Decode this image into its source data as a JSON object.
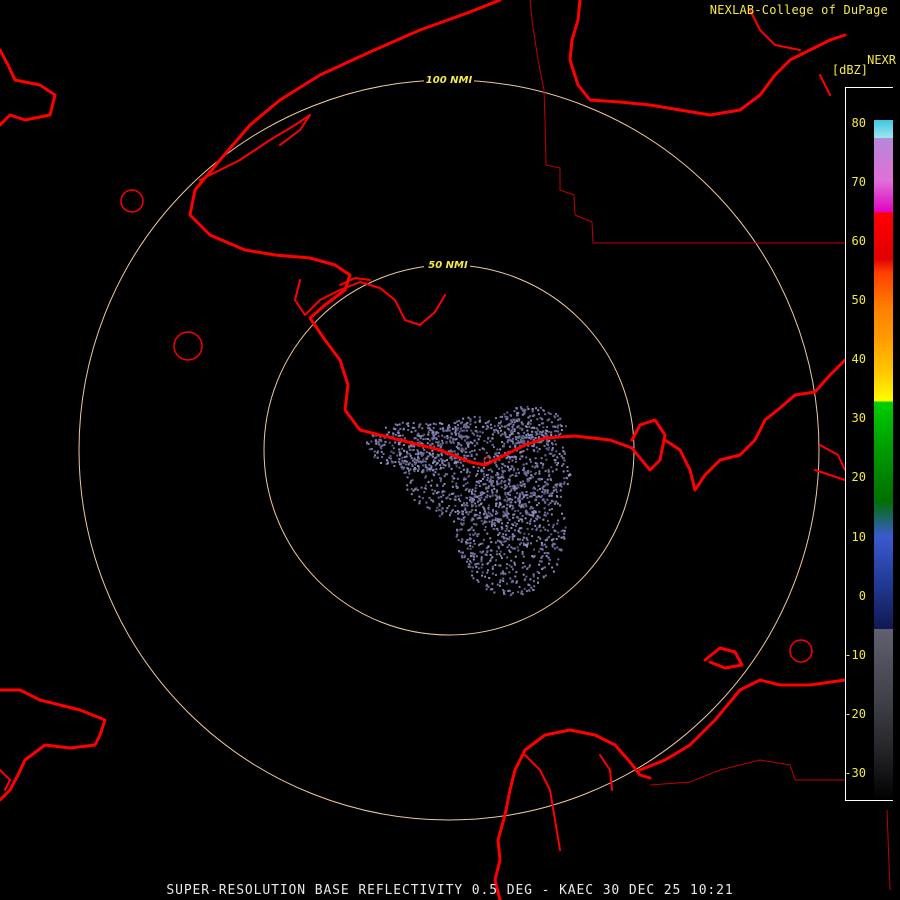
{
  "credit": "NEXLAB-College of DuPage",
  "product": "NEXR",
  "units": "[dBZ]",
  "caption": "SUPER-RESOLUTION BASE REFLECTIVITY 0.5 DEG - KAEC 30 DEC 25 10:21",
  "range_rings": [
    {
      "label": "50 NMI"
    },
    {
      "label": "100 NMI"
    }
  ],
  "legend": {
    "ticks": [
      "80",
      "70",
      "60",
      "50",
      "40",
      "30",
      "20",
      "10",
      "0",
      "-10",
      "-20",
      "-30"
    ]
  },
  "colors": {
    "coastline": "#ff0000",
    "boundary": "#c00000",
    "rings": "#f0c8a0",
    "text": "#f5e94a",
    "echo": "#7a7aa8"
  }
}
